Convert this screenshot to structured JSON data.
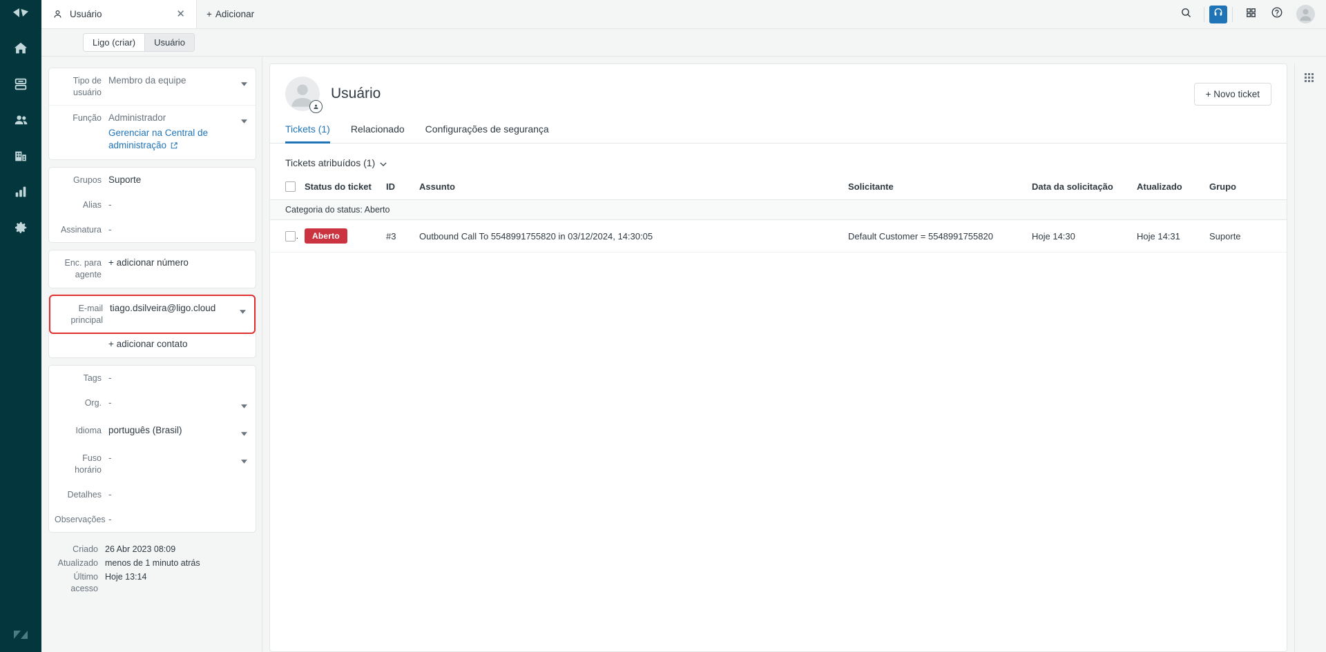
{
  "brand": {
    "accent": "#1f73b7",
    "rail_bg": "#03363D",
    "status_red": "#cc3340",
    "highlight": "#e02f2f"
  },
  "topbar": {
    "tab": {
      "label": "Usuário",
      "icon": "user-icon",
      "close_icon": "close-icon"
    },
    "add_tab": {
      "label": "Adicionar",
      "icon": "plus-icon"
    },
    "actions": {
      "search_icon": "search-icon",
      "headset_icon": "headset-icon",
      "apps_grid_icon": "grid-apps-icon",
      "help_icon": "help-circle-icon",
      "avatar": "user-avatar"
    }
  },
  "subbar": {
    "crumbs": [
      {
        "label": "Ligo (criar)",
        "active": false
      },
      {
        "label": "Usuário",
        "active": true
      }
    ]
  },
  "rail": {
    "logo": "zendesk-logo",
    "items": [
      {
        "name": "home",
        "icon": "home-icon"
      },
      {
        "name": "views",
        "icon": "views-icon"
      },
      {
        "name": "customers",
        "icon": "customers-icon"
      },
      {
        "name": "organizations",
        "icon": "organizations-icon"
      },
      {
        "name": "reporting",
        "icon": "reporting-icon"
      },
      {
        "name": "admin",
        "icon": "gear-icon"
      }
    ],
    "bottom_logo": "zendesk-z-logo"
  },
  "sidebar": {
    "cards": [
      {
        "rows": [
          {
            "label": "Tipo de usuário",
            "value": "Membro da equipe",
            "muted": true,
            "caret": true
          },
          {
            "label": "Função",
            "value": "Administrador",
            "muted": true,
            "caret": true,
            "link": "Gerenciar na Central de administração",
            "link_icon": "external-link-icon"
          }
        ]
      },
      {
        "rows": [
          {
            "label": "Grupos",
            "value": "Suporte",
            "muted": false,
            "caret": false
          },
          {
            "label": "Alias",
            "value": "-",
            "muted": true,
            "caret": false
          },
          {
            "label": "Assinatura",
            "value": "-",
            "muted": true,
            "caret": false
          }
        ]
      },
      {
        "rows": [
          {
            "label": "Enc. para agente",
            "add_label": "+ adicionar número"
          }
        ]
      },
      {
        "highlighted_row": {
          "label": "E-mail principal",
          "value": "tiago.dsilveira@ligo.cloud",
          "caret": true
        },
        "add_label": "+ adicionar contato"
      },
      {
        "rows": [
          {
            "label": "Tags",
            "value": "-",
            "muted": true,
            "caret": false
          },
          {
            "label": "Org.",
            "value": "-",
            "muted": true,
            "caret": true
          },
          {
            "label": "Idioma",
            "value": "português (Brasil)",
            "muted": false,
            "caret": true
          },
          {
            "label": "Fuso horário",
            "value": "-",
            "muted": true,
            "caret": true
          },
          {
            "label": "Detalhes",
            "value": "-",
            "muted": true,
            "caret": false
          },
          {
            "label": "Observações",
            "value": "-",
            "muted": true,
            "caret": false
          }
        ]
      }
    ],
    "meta": [
      {
        "label": "Criado",
        "value": "26 Abr 2023 08:09"
      },
      {
        "label": "Atualizado",
        "value": "menos de 1 minuto atrás"
      },
      {
        "label": "Último acesso",
        "value": "Hoje 13:14"
      }
    ]
  },
  "main": {
    "user": {
      "name": "Usuário",
      "avatar_icon": "user-avatar-icon",
      "badge_icon": "agent-badge-icon"
    },
    "new_ticket_button": "+ Novo ticket",
    "tabs": [
      {
        "label": "Tickets (1)",
        "active": true
      },
      {
        "label": "Relacionado",
        "active": false
      },
      {
        "label": "Configurações de segurança",
        "active": false
      }
    ],
    "list": {
      "title": "Tickets atribuídos (1)",
      "title_caret": "chevron-down-icon",
      "columns": [
        "Status do ticket",
        "ID",
        "Assunto",
        "Solicitante",
        "Data da solicitação",
        "Atualizado",
        "Grupo"
      ],
      "group_header": "Categoria do status: Aberto",
      "rows": [
        {
          "status": "Aberto",
          "id": "#3",
          "subject": "Outbound Call To 5548991755820 in 03/12/2024, 14:30:05",
          "requester": "Default Customer = 5548991755820",
          "requested_at": "Hoje 14:30",
          "updated_at": "Hoje 14:31",
          "group": "Suporte"
        }
      ]
    }
  },
  "apps_rail": {
    "icon": "apps-grid-icon"
  }
}
